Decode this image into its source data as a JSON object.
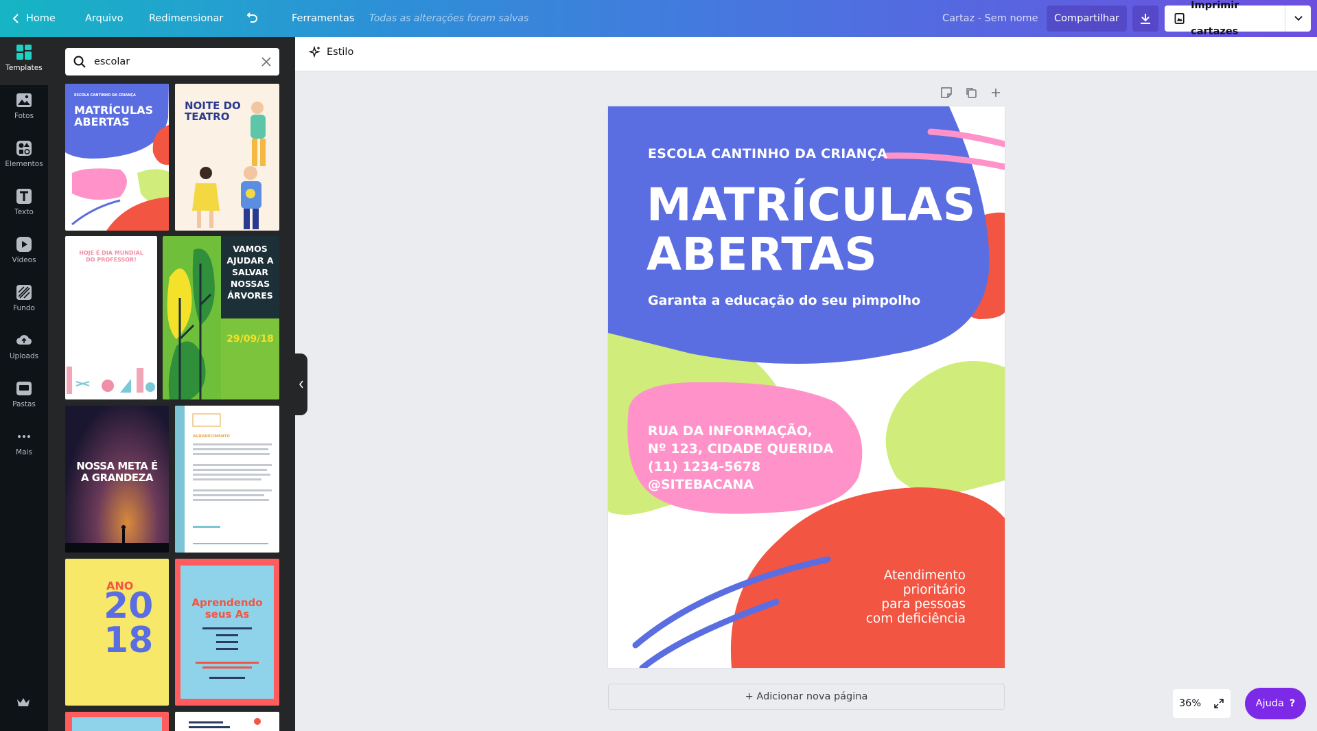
{
  "topbar": {
    "home": "Home",
    "arquivo": "Arquivo",
    "redimensionar": "Redimensionar",
    "ferramentas": "Ferramentas",
    "saved_status": "Todas as alterações foram salvas",
    "doc_name": "Cartaz - Sem nome",
    "share": "Compartilhar",
    "print": "Imprimir cartazes"
  },
  "rail": {
    "items": [
      {
        "label": "Templates",
        "icon": "templates-icon",
        "active": true
      },
      {
        "label": "Fotos",
        "icon": "photo-icon"
      },
      {
        "label": "Elementos",
        "icon": "shapes-icon"
      },
      {
        "label": "Texto",
        "icon": "text-icon"
      },
      {
        "label": "Vídeos",
        "icon": "video-icon"
      },
      {
        "label": "Fundo",
        "icon": "background-icon"
      },
      {
        "label": "Uploads",
        "icon": "upload-icon"
      },
      {
        "label": "Pastas",
        "icon": "folder-icon"
      },
      {
        "label": "Mais",
        "icon": "more-icon"
      }
    ]
  },
  "search": {
    "value": "escolar"
  },
  "thumbs": {
    "t1": {
      "school": "ESCOLA CANTINHO DA CRIANÇA",
      "title1": "MATRÍCULAS",
      "title2": "ABERTAS"
    },
    "t2": {
      "title1": "NOITE DO",
      "title2": "TEATRO"
    },
    "t3": {
      "title1": "HOJE É DIA MUNDIAL",
      "title2": "DO PROFESSOR!"
    },
    "t4": {
      "l1": "VAMOS",
      "l2": "AJUDAR A",
      "l3": "SALVAR",
      "l4": "NOSSAS",
      "l5": "ÁRVORES",
      "date": "29/09/18"
    },
    "t5": {
      "l1": "NOSSA META É",
      "l2": "A GRANDEZA"
    },
    "t6": {
      "title": "AGRADECIMENTO"
    },
    "t7": {
      "l1": "ANO",
      "l2": "20",
      "l3": "18"
    },
    "t8": {
      "l1": "Aprendendo",
      "l2": "seus As"
    }
  },
  "toolbar": {
    "estilo": "Estilo"
  },
  "poster": {
    "school": "ESCOLA CANTINHO DA CRIANÇA",
    "title_line1": "MATRÍCULAS",
    "title_line2": "ABERTAS",
    "subtitle": "Garanta a educação do seu pimpolho",
    "address1": "RUA DA INFORMAÇÃO,",
    "address2": "Nº 123, CIDADE QUERIDA",
    "phone": "(11) 1234-5678",
    "site": "@SITEBACANA",
    "atend1": "Atendimento",
    "atend2": "prioritário",
    "atend3": "para pessoas",
    "atend4": "com deficiência"
  },
  "add_page": "+ Adicionar nova página",
  "zoom": "36%",
  "help": "Ajuda",
  "colors": {
    "blue": "#5b6ee1",
    "red": "#f25541",
    "pink": "#ff93c9",
    "green": "#d0ec7a",
    "purple": "#7d2ae8"
  }
}
